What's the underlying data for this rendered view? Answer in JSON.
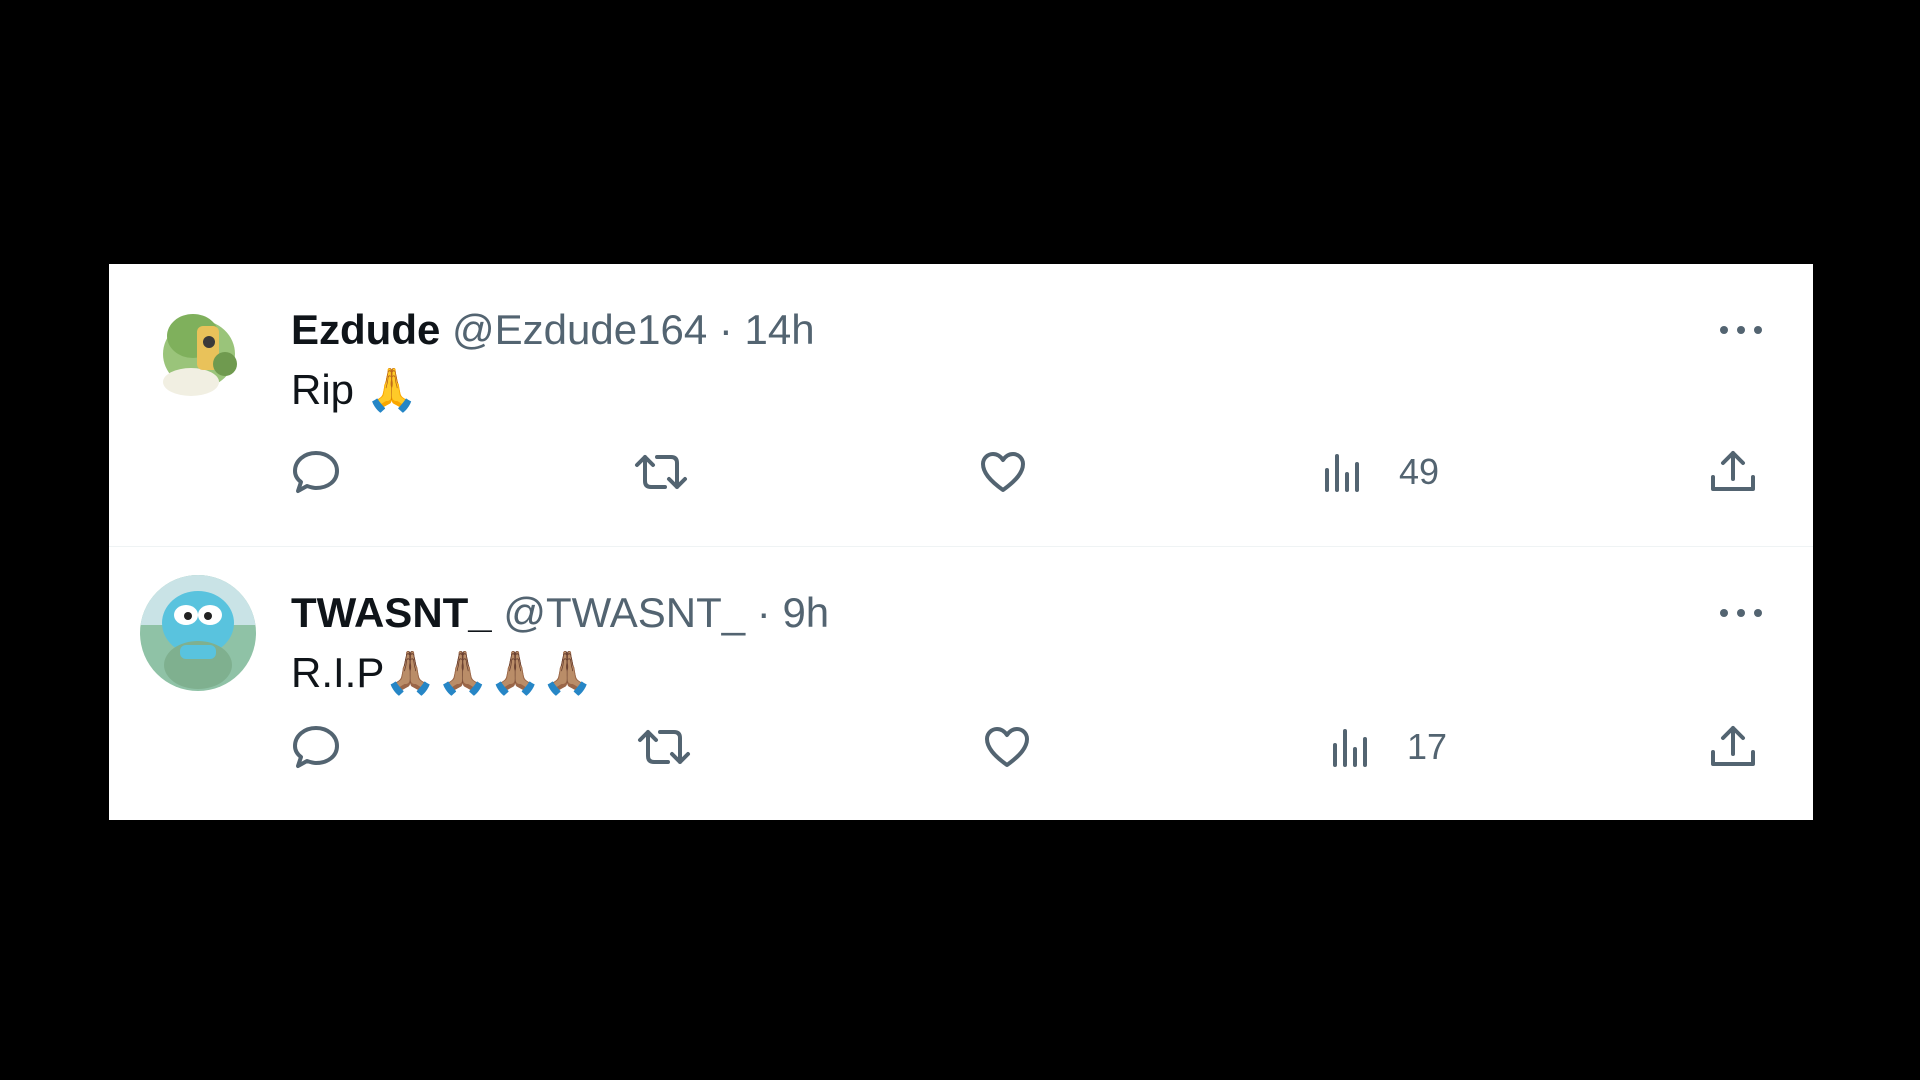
{
  "tweets": [
    {
      "display_name": "Ezdude",
      "handle": "@Ezdude164",
      "separator": "·",
      "time": "14h",
      "text": "Rip 🙏",
      "views": "49",
      "avatar_colors": [
        "#9ac47a",
        "#f1efe2"
      ]
    },
    {
      "display_name": "TWASNT_",
      "handle": "@TWASNT_",
      "separator": "·",
      "time": "9h",
      "text": "R.I.P🙏🏽🙏🏽🙏🏽🙏🏽",
      "views": "17",
      "avatar_colors": [
        "#59c3de",
        "#8fc2a6"
      ]
    }
  ],
  "icons": [
    "reply-icon",
    "retweet-icon",
    "like-icon",
    "views-icon",
    "share-icon",
    "more-icon"
  ],
  "colors": {
    "background": "#000000",
    "card": "#ffffff",
    "text_primary": "#0f1419",
    "text_secondary": "#536471"
  }
}
